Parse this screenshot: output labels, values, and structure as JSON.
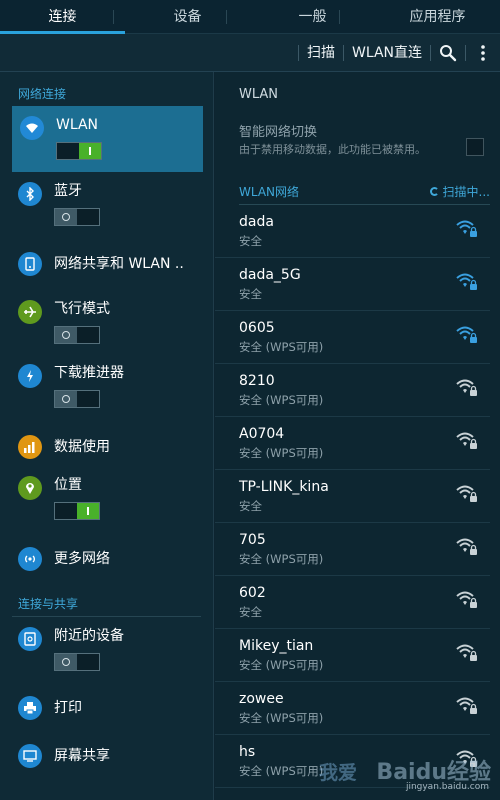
{
  "tabs": [
    {
      "label": "连接",
      "active": true
    },
    {
      "label": "设备",
      "active": false
    },
    {
      "label": "一般",
      "active": false
    },
    {
      "label": "应用程序",
      "active": false
    }
  ],
  "actionbar": {
    "scan_label": "扫描",
    "direct_label": "WLAN直连",
    "search_icon": "search-icon",
    "more_icon": "more-vert-icon"
  },
  "left": {
    "section1": "网络连接",
    "items": [
      {
        "label": "WLAN",
        "icon": "wifi-icon",
        "toggle": "on"
      },
      {
        "label": "蓝牙",
        "icon": "bluetooth-icon",
        "toggle": "off"
      },
      {
        "label": "网络共享和 WLAN ..",
        "icon": "tethering-icon"
      },
      {
        "label": "飞行模式",
        "icon": "airplane-icon",
        "toggle": "off"
      },
      {
        "label": "下载推进器",
        "icon": "download-booster-icon",
        "toggle": "off"
      },
      {
        "label": "数据使用",
        "icon": "data-usage-icon"
      },
      {
        "label": "位置",
        "icon": "location-icon",
        "toggle": "on"
      },
      {
        "label": "更多网络",
        "icon": "more-networks-icon"
      }
    ],
    "section2": "连接与共享",
    "items2": [
      {
        "label": "附近的设备",
        "icon": "nearby-devices-icon",
        "toggle": "off"
      },
      {
        "label": "打印",
        "icon": "print-icon"
      },
      {
        "label": "屏幕共享",
        "icon": "screen-mirroring-icon"
      }
    ]
  },
  "right": {
    "title": "WLAN",
    "smart_title": "智能网络切换",
    "smart_desc": "由于禁用移动数据，此功能已被禁用。",
    "networks_header": "WLAN网络",
    "scanning": "扫描中...",
    "networks": [
      {
        "ssid": "dada",
        "security": "安全",
        "signal": "strong"
      },
      {
        "ssid": "dada_5G",
        "security": "安全",
        "signal": "strong"
      },
      {
        "ssid": "0605",
        "security": "安全 (WPS可用)",
        "signal": "strong"
      },
      {
        "ssid": "8210",
        "security": "安全 (WPS可用)",
        "signal": "weak"
      },
      {
        "ssid": "A0704",
        "security": "安全 (WPS可用)",
        "signal": "weak"
      },
      {
        "ssid": "TP-LINK_kina",
        "security": "安全",
        "signal": "weak"
      },
      {
        "ssid": "705",
        "security": "安全 (WPS可用)",
        "signal": "weak"
      },
      {
        "ssid": "602",
        "security": "安全",
        "signal": "weak"
      },
      {
        "ssid": "Mikey_tian",
        "security": "安全 (WPS可用)",
        "signal": "weak"
      },
      {
        "ssid": "zowee",
        "security": "安全 (WPS可用)",
        "signal": "weak"
      },
      {
        "ssid": "hs",
        "security": "安全 (WPS可用)",
        "signal": "weak"
      }
    ]
  },
  "watermark": {
    "cn": "我爱",
    "brand": "Baidu经验",
    "url": "jingyan.baidu.com"
  },
  "colors": {
    "accent": "#3fa8d9",
    "selected": "#1c6e92",
    "toggle_on": "#49b12a",
    "wifi_strong": "#3aa0e0",
    "wifi_weak": "#c9d2d6"
  }
}
